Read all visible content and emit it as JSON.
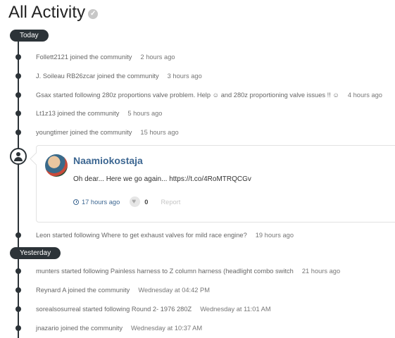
{
  "header": {
    "title": "All Activity",
    "check_glyph": "✓",
    "check_icon": "check-circle-icon"
  },
  "groups": {
    "today": "Today",
    "yesterday": "Yesterday"
  },
  "today_items": [
    {
      "text": "Follett2121 joined the community",
      "time": "2 hours ago"
    },
    {
      "text": "J. Soileau RB26zcar joined the community",
      "time": "3 hours ago"
    },
    {
      "text": "Gsax started following 280z proportions valve problem. Help ☺ and 280z proportioning valve issues !! ☺",
      "time": "4 hours ago"
    },
    {
      "text": "Lt1z13 joined the community",
      "time": "5 hours ago"
    },
    {
      "text": "youngtimer joined the community",
      "time": "15 hours ago"
    }
  ],
  "status_card": {
    "author": "Naamiokostaja",
    "text": "Oh dear... Here we go again... https://t.co/4RoMTRQCGv",
    "time": "17 hours ago",
    "likes": "0",
    "report_label": "Report",
    "icons": [
      "user-icon",
      "clock-icon",
      "heart-icon"
    ]
  },
  "today_after_card": {
    "text": "Leon started following Where to get exhaust valves for mild race engine?",
    "time": "19 hours ago"
  },
  "yesterday_items": [
    {
      "text": "munters started following Painless harness to Z column harness (headlight combo switch",
      "time": "21 hours ago"
    },
    {
      "text": "Reynard A joined the community",
      "time": "Wednesday at 04:42 PM"
    },
    {
      "text": "sorealsosurreal started following Round 2- 1976 280Z",
      "time": "Wednesday at 11:01 AM"
    },
    {
      "text": "jnazario joined the community",
      "time": "Wednesday at 10:37 AM"
    }
  ],
  "colors": {
    "timeline": "#2c3338",
    "link": "#3d6792",
    "text": "#666666"
  }
}
